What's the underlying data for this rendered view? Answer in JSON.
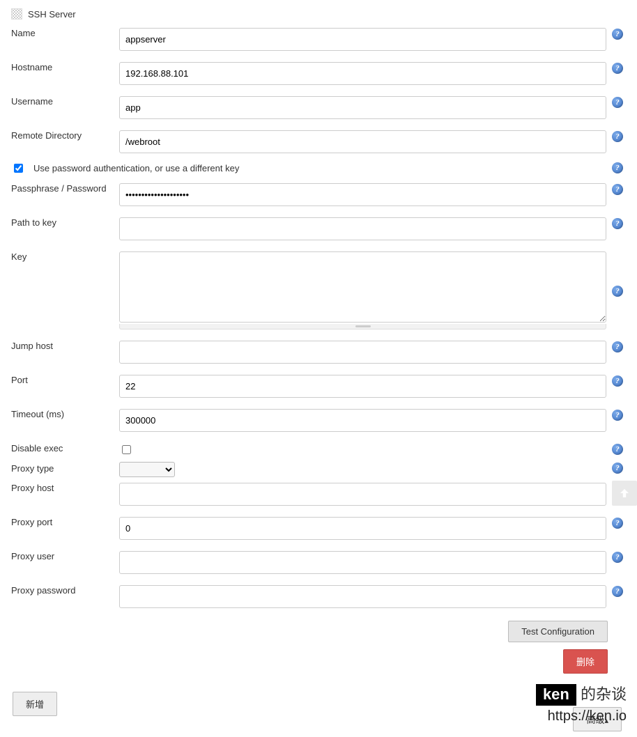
{
  "section_title": "SSH Server",
  "labels": {
    "name": "Name",
    "hostname": "Hostname",
    "username": "Username",
    "remote_directory": "Remote Directory",
    "use_password_auth": "Use password authentication, or use a different key",
    "passphrase": "Passphrase / Password",
    "path_to_key": "Path to key",
    "key": "Key",
    "jump_host": "Jump host",
    "port": "Port",
    "timeout": "Timeout (ms)",
    "disable_exec": "Disable exec",
    "proxy_type": "Proxy type",
    "proxy_host": "Proxy host",
    "proxy_port": "Proxy port",
    "proxy_user": "Proxy user",
    "proxy_password": "Proxy password"
  },
  "values": {
    "name": "appserver",
    "hostname": "192.168.88.101",
    "username": "app",
    "remote_directory": "/webroot",
    "use_password_auth_checked": true,
    "passphrase": "••••••••••••••••••••",
    "path_to_key": "",
    "key": "",
    "jump_host": "",
    "port": "22",
    "timeout": "300000",
    "disable_exec_checked": false,
    "proxy_type": "",
    "proxy_host": "",
    "proxy_port": "0",
    "proxy_user": "",
    "proxy_password": ""
  },
  "buttons": {
    "test_config": "Test Configuration",
    "delete": "删除",
    "add": "新增",
    "advanced": "高级"
  },
  "watermark": {
    "ken": "ken",
    "suffix": "的杂谈",
    "url": "https://ken.io"
  },
  "help_glyph": "?"
}
